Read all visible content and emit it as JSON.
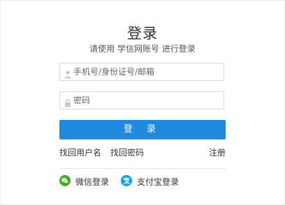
{
  "login": {
    "title": "登录",
    "subtitle": "请使用 学信网账号 进行登录",
    "username_placeholder": "手机号/身份证号/邮箱",
    "password_placeholder": "密码",
    "submit_label": "登 录",
    "forgot_username": "找回用户名",
    "forgot_password": "找回密码",
    "register": "注册",
    "wechat_login": "微信登录",
    "alipay_login": "支付宝登录"
  },
  "colors": {
    "primary_button": "#1e8ae0",
    "wechat_green": "#3db01f",
    "alipay_blue": "#00a7e8"
  },
  "icons": {
    "username": "user-icon",
    "password": "lock-icon",
    "wechat": "wechat-icon",
    "alipay": "alipay-icon"
  }
}
